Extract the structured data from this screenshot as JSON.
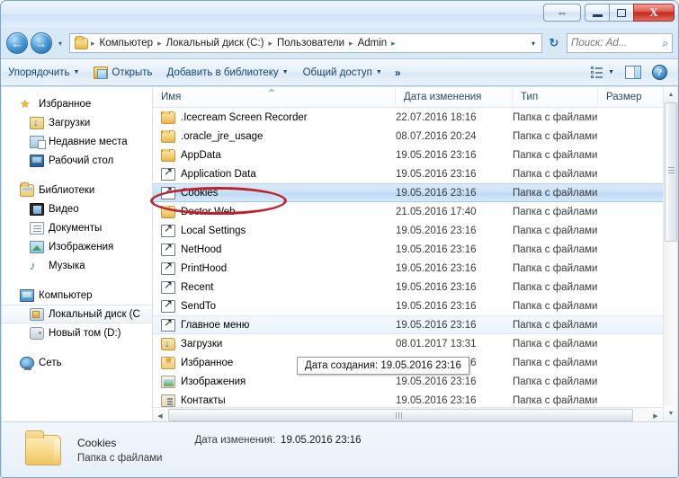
{
  "window": {
    "controls": {
      "restore_up_icon": "restore-updown-icon",
      "minimize_label": "",
      "maximize_label": "",
      "close_label": "X"
    }
  },
  "address_bar": {
    "back_icon": "←",
    "forward_icon": "→",
    "history_caret": "▾",
    "folder_icon": "folder-icon",
    "crumbs": [
      "Компьютер",
      "Локальный диск (C:)",
      "Пользователи",
      "Admin"
    ],
    "separator": "▸",
    "trailing_separator": "▸",
    "dropdown_caret": "▾",
    "refresh_icon": "↻",
    "search_placeholder": "Поиск: Ad...",
    "search_value": "",
    "search_icon": "⌕"
  },
  "toolbar": {
    "organize_label": "Упорядочить",
    "open_label": "Открыть",
    "add_to_library_label": "Добавить в библиотеку",
    "share_label": "Общий доступ",
    "overflow_label": "»",
    "caret": "▼",
    "views_caret": "▼",
    "views_icon": "view-list-icon",
    "preview_pane_icon": "preview-pane-icon",
    "help_icon": "?"
  },
  "nav_pane": {
    "groups": [
      {
        "header": {
          "label": "Избранное",
          "icon": "star-icon",
          "icon_class": "ico-star"
        },
        "items": [
          {
            "label": "Загрузки",
            "icon": "downloads-icon",
            "icon_class": "ico-dl"
          },
          {
            "label": "Недавние места",
            "icon": "recent-places-icon",
            "icon_class": "ico-recent"
          },
          {
            "label": "Рабочий стол",
            "icon": "desktop-icon",
            "icon_class": "ico-desktop"
          }
        ]
      },
      {
        "header": {
          "label": "Библиотеки",
          "icon": "libraries-icon",
          "icon_class": "ico-lib"
        },
        "items": [
          {
            "label": "Видео",
            "icon": "video-icon",
            "icon_class": "ico-video"
          },
          {
            "label": "Документы",
            "icon": "documents-icon",
            "icon_class": "ico-docs"
          },
          {
            "label": "Изображения",
            "icon": "pictures-icon",
            "icon_class": "ico-pics"
          },
          {
            "label": "Музыка",
            "icon": "music-icon",
            "icon_class": "ico-music"
          }
        ]
      },
      {
        "header": {
          "label": "Компьютер",
          "icon": "computer-icon",
          "icon_class": "ico-comp"
        },
        "items": [
          {
            "label": "Локальный диск (C",
            "icon": "hard-drive-icon",
            "icon_class": "ico-drive",
            "selected": true
          },
          {
            "label": "Новый том (D:)",
            "icon": "hard-drive-icon",
            "icon_class": "ico-drive2"
          }
        ]
      },
      {
        "header": {
          "label": "Сеть",
          "icon": "network-icon",
          "icon_class": "ico-net"
        },
        "items": []
      }
    ]
  },
  "file_list": {
    "columns": [
      {
        "label": "Имя",
        "key": "name"
      },
      {
        "label": "Дата изменения",
        "key": "date"
      },
      {
        "label": "Тип",
        "key": "type"
      },
      {
        "label": "Размер",
        "key": "size"
      }
    ],
    "sort_indicator": "ascending",
    "rows": [
      {
        "name": ".Icecream Screen Recorder",
        "date": "22.07.2016 18:16",
        "type": "Папка с файлами",
        "size": "",
        "icon": "folder-icon",
        "icon_class": "ri-folder",
        "state": ""
      },
      {
        "name": ".oracle_jre_usage",
        "date": "08.07.2016 20:24",
        "type": "Папка с файлами",
        "size": "",
        "icon": "folder-icon",
        "icon_class": "ri-folder",
        "state": ""
      },
      {
        "name": "AppData",
        "date": "19.05.2016 23:16",
        "type": "Папка с файлами",
        "size": "",
        "icon": "folder-icon",
        "icon_class": "ri-folder",
        "state": ""
      },
      {
        "name": "Application Data",
        "date": "19.05.2016 23:16",
        "type": "Папка с файлами",
        "size": "",
        "icon": "junction-folder-icon",
        "icon_class": "ri-junction",
        "state": ""
      },
      {
        "name": "Cookies",
        "date": "19.05.2016 23:16",
        "type": "Папка с файлами",
        "size": "",
        "icon": "junction-folder-icon",
        "icon_class": "ri-junction",
        "state": "selected"
      },
      {
        "name": "Doctor Web",
        "date": "21.05.2016 17:40",
        "type": "Папка с файлами",
        "size": "",
        "icon": "folder-icon",
        "icon_class": "ri-folder",
        "state": ""
      },
      {
        "name": "Local Settings",
        "date": "19.05.2016 23:16",
        "type": "Папка с файлами",
        "size": "",
        "icon": "junction-folder-icon",
        "icon_class": "ri-junction",
        "state": ""
      },
      {
        "name": "NetHood",
        "date": "19.05.2016 23:16",
        "type": "Папка с файлами",
        "size": "",
        "icon": "junction-folder-icon",
        "icon_class": "ri-junction",
        "state": ""
      },
      {
        "name": "PrintHood",
        "date": "19.05.2016 23:16",
        "type": "Папка с файлами",
        "size": "",
        "icon": "junction-folder-icon",
        "icon_class": "ri-junction",
        "state": ""
      },
      {
        "name": "Recent",
        "date": "19.05.2016 23:16",
        "type": "Папка с файлами",
        "size": "",
        "icon": "junction-folder-icon",
        "icon_class": "ri-junction",
        "state": ""
      },
      {
        "name": "SendTo",
        "date": "19.05.2016 23:16",
        "type": "Папка с файлами",
        "size": "",
        "icon": "junction-folder-icon",
        "icon_class": "ri-junction",
        "state": ""
      },
      {
        "name": "Главное меню",
        "date": "19.05.2016 23:16",
        "type": "Папка с файлами",
        "size": "",
        "icon": "junction-folder-icon",
        "icon_class": "ri-junction",
        "state": "hovered"
      },
      {
        "name": "Загрузки",
        "date": "08.01.2017 13:31",
        "type": "Папка с файлами",
        "size": "",
        "icon": "downloads-folder-icon",
        "icon_class": "ri-dl",
        "state": ""
      },
      {
        "name": "Избранное",
        "date": "19.05.2016 23:16",
        "type": "Папка с файлами",
        "size": "",
        "icon": "favorites-folder-icon",
        "icon_class": "ri-fav",
        "state": ""
      },
      {
        "name": "Изображения",
        "date": "19.05.2016 23:16",
        "type": "Папка с файлами",
        "size": "",
        "icon": "pictures-folder-icon",
        "icon_class": "ri-pics",
        "state": ""
      },
      {
        "name": "Контакты",
        "date": "19.05.2016 23:16",
        "type": "Папка с файлами",
        "size": "",
        "icon": "contacts-folder-icon",
        "icon_class": "ri-contacts",
        "state": ""
      }
    ]
  },
  "tooltip": {
    "text": "Дата создания: 19.05.2016 23:16"
  },
  "details_pane": {
    "name": "Cookies",
    "type": "Папка с файлами",
    "modified_label": "Дата изменения:",
    "modified_value": "19.05.2016 23:16"
  },
  "annotation": {
    "shape": "ellipse",
    "color": "#c0202a",
    "target": "Cookies"
  },
  "scrollbars": {
    "up_arrow": "▲",
    "down_arrow": "▼",
    "left_arrow": "◀",
    "right_arrow": "▶"
  }
}
